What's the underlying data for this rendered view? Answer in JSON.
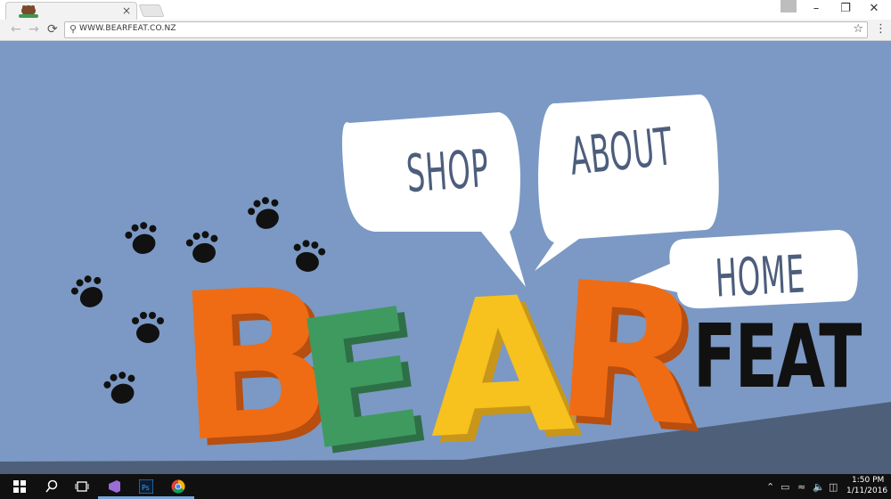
{
  "browser": {
    "url": "WWW.BEARFEAT.CO.NZ",
    "tab_close": "×",
    "controls": {
      "minimize": "–",
      "restore": "❐",
      "close": "✕"
    },
    "nav": {
      "back": "←",
      "forward": "→",
      "reload": "⟳"
    },
    "icons": {
      "search": "search-icon",
      "star": "star-icon",
      "menu": "more-vert-icon"
    }
  },
  "site": {
    "nav": {
      "shop": "SHOP",
      "about": "ABOUT",
      "home": "HOME"
    },
    "logo": {
      "letters": [
        "B",
        "E",
        "A",
        "R"
      ],
      "word2": "FEAT"
    },
    "colors": {
      "background": "#7b99c4",
      "ground": "#4e5f79",
      "letter_b": "#ef6c14",
      "letter_e": "#3f9a60",
      "letter_a": "#f7c11e",
      "letter_r": "#ef6c14",
      "bubble_text": "#4d5e7c"
    }
  },
  "taskbar": {
    "time": "1:50 PM",
    "date": "1/11/2016",
    "apps": [
      "start-icon",
      "search-icon",
      "task-view-icon",
      "visual-studio-icon",
      "photoshop-icon",
      "chrome-icon"
    ]
  }
}
